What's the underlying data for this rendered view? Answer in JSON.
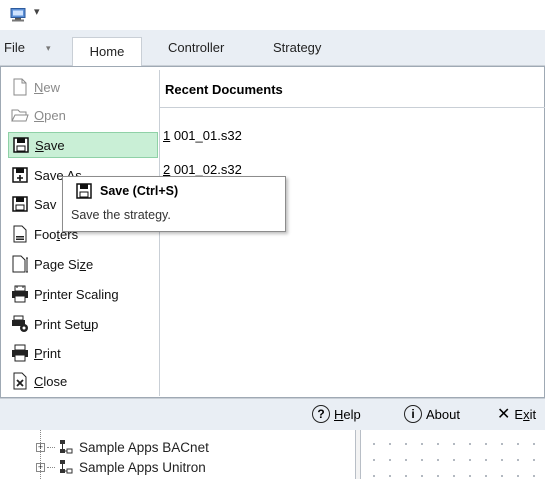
{
  "titlebar": {
    "qat_arrow": "▾"
  },
  "ribbon": {
    "tabs": [
      {
        "label": "File"
      },
      {
        "label": "Home"
      },
      {
        "label": "Controller"
      },
      {
        "label": "Strategy"
      }
    ],
    "file_arrow": "▾"
  },
  "file_menu": {
    "items": [
      {
        "label": "New",
        "accel": "N",
        "rest": "ew",
        "state": "disabled",
        "icon": "new-document-icon"
      },
      {
        "label": "Open",
        "accel": "O",
        "rest": "pen",
        "state": "disabled",
        "icon": "open-folder-icon"
      },
      {
        "label": "Save",
        "accel": "S",
        "rest": "ave",
        "state": "selected",
        "icon": "save-disk-icon"
      },
      {
        "label": "Save As",
        "pre": "Sav",
        "rest": "e As",
        "icon": "save-as-icon"
      },
      {
        "label": "Save All",
        "pre": "Sav",
        "icon": "save-all-icon"
      },
      {
        "label": "Footers",
        "pre": "Foo",
        "accel": "t",
        "rest": "ers",
        "icon": "footers-icon"
      },
      {
        "label": "Page Size",
        "pre": "Page Si",
        "accel": "z",
        "rest": "e",
        "icon": "page-size-icon"
      },
      {
        "label": "Printer Scaling",
        "pre": "P",
        "accel": "r",
        "rest": "inter Scaling",
        "icon": "printer-scaling-icon"
      },
      {
        "label": "Print Setup",
        "pre": "Print Set",
        "accel": "u",
        "rest": "p",
        "icon": "print-setup-icon"
      },
      {
        "label": "Print",
        "accel": "P",
        "rest": "rint",
        "icon": "printer-icon"
      },
      {
        "label": "Close",
        "accel": "C",
        "rest": "lose",
        "icon": "close-doc-icon"
      }
    ]
  },
  "recent": {
    "title": "Recent Documents",
    "docs": [
      {
        "num": "1",
        "name": " 001_01.s32"
      },
      {
        "num": "2",
        "name": " 001_02.s32"
      }
    ]
  },
  "tooltip": {
    "title": "Save (Ctrl+S)",
    "description": "Save the strategy."
  },
  "bottom_bar": {
    "help": {
      "accel": "H",
      "rest": "elp"
    },
    "about": "About",
    "exit": {
      "pre": "E",
      "accel": "x",
      "rest": "it"
    }
  },
  "tree": {
    "nodes": [
      {
        "label": "Sample Apps BACnet"
      },
      {
        "label": "Sample Apps Unitron"
      }
    ]
  }
}
